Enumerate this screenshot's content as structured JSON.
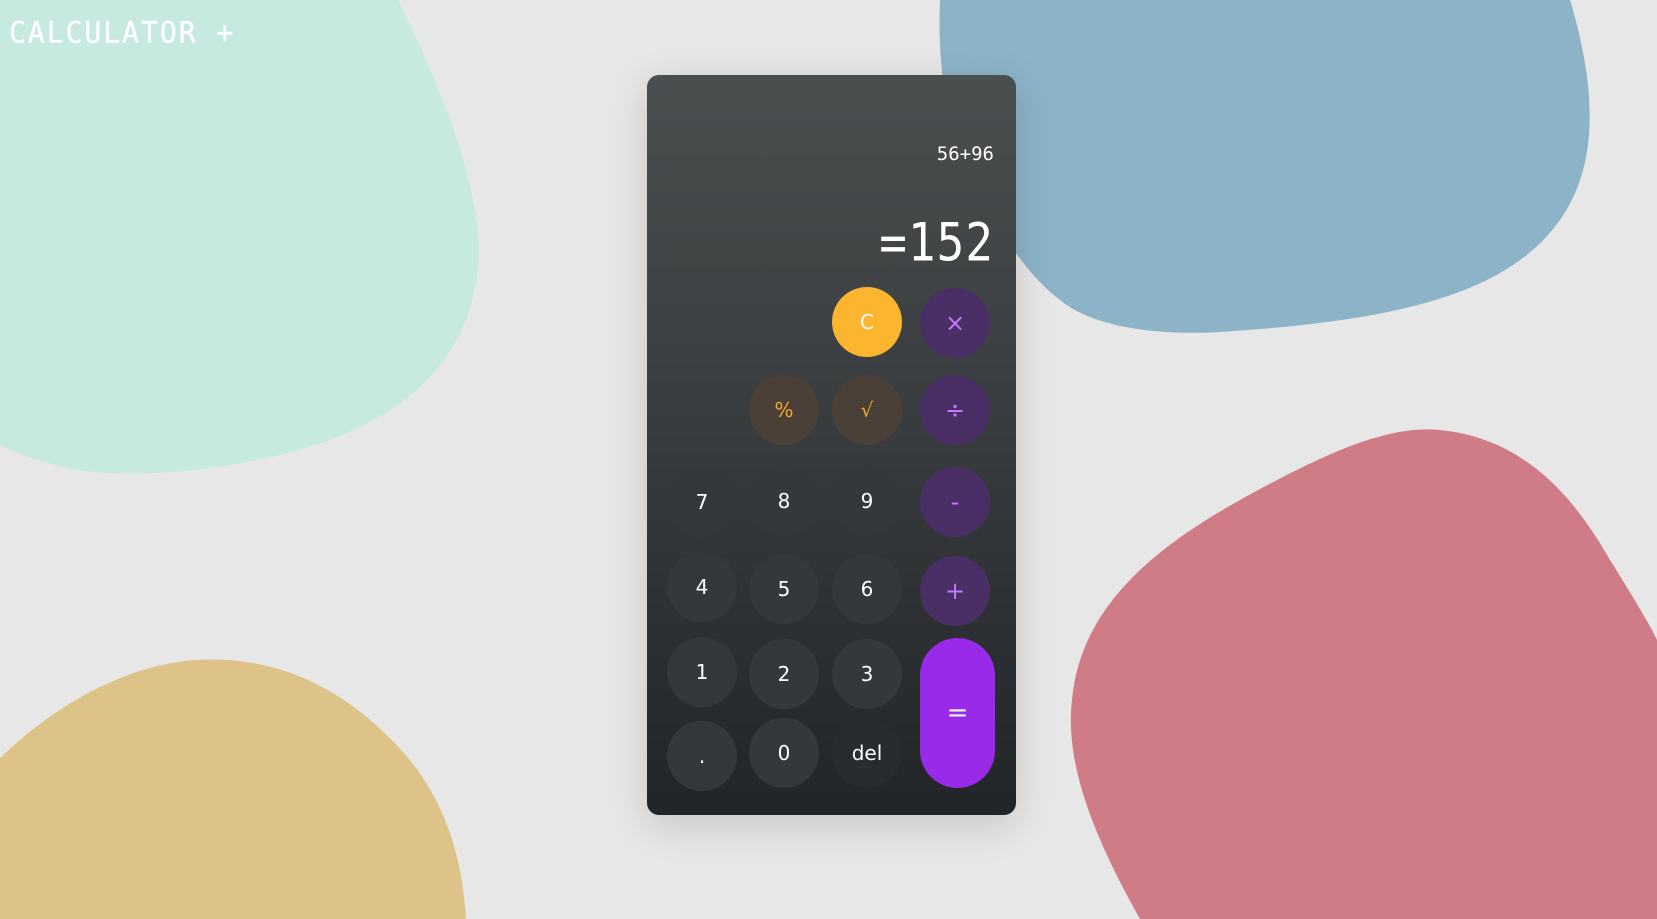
{
  "app": {
    "title": "CALCULATOR +"
  },
  "display": {
    "expression": "56+96",
    "result": "=152"
  },
  "keys": {
    "clear": "C",
    "multiply": "×",
    "percent": "%",
    "sqrt": "√",
    "divide": "÷",
    "seven": "7",
    "eight": "8",
    "nine": "9",
    "minus": "-",
    "four": "4",
    "five": "5",
    "six": "6",
    "plus": "+",
    "one": "1",
    "two": "2",
    "three": "3",
    "equals": "=",
    "dot": ".",
    "zero": "0",
    "del": "del"
  },
  "colors": {
    "background": "#e7e7e7",
    "blob_mint": "#c6eadf",
    "blob_blue": "#8cb3c8",
    "blob_pink": "#d07c87",
    "blob_sand": "#ddc388",
    "clear_key": "#fbb52f",
    "operator_key": "#4a2f66",
    "operator_text": "#c676ff",
    "equals_key": "#9a2aea",
    "number_key": "#34383a",
    "function_text": "#f0a92c"
  }
}
